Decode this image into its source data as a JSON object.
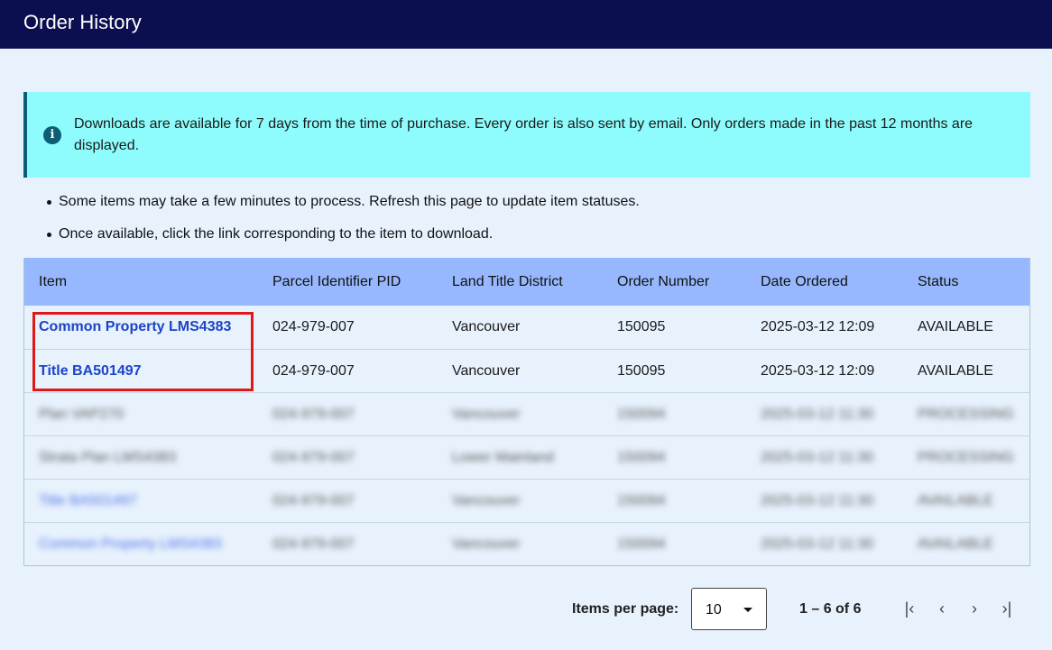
{
  "header": {
    "title": "Order History"
  },
  "info": {
    "icon": "info-icon",
    "text": "Downloads are available for 7 days from the time of purchase. Every order is also sent by email. Only orders made in the past 12 months are displayed."
  },
  "notes": [
    "Some items may take a few minutes to process. Refresh this page to update item statuses.",
    "Once available, click the link corresponding to the item to download."
  ],
  "table": {
    "columns": [
      "Item",
      "Parcel Identifier PID",
      "Land Title District",
      "Order Number",
      "Date Ordered",
      "Status"
    ],
    "rows": [
      {
        "item": "Common Property LMS4383",
        "pid": "024-979-007",
        "district": "Vancouver",
        "order": "150095",
        "date": "2025-03-12 12:09",
        "status": "AVAILABLE"
      },
      {
        "item": "Title BA501497",
        "pid": "024-979-007",
        "district": "Vancouver",
        "order": "150095",
        "date": "2025-03-12 12:09",
        "status": "AVAILABLE"
      },
      {
        "item": "Plan VAP270",
        "pid": "024-979-007",
        "district": "Vancouver",
        "order": "150094",
        "date": "2025-03-12 11:30",
        "status": "PROCESSING"
      },
      {
        "item": "Strata Plan LMS4383",
        "pid": "024-979-007",
        "district": "Lower Mainland",
        "order": "150094",
        "date": "2025-03-12 11:30",
        "status": "PROCESSING"
      },
      {
        "item": "Title BA501497",
        "pid": "024-979-007",
        "district": "Vancouver",
        "order": "150094",
        "date": "2025-03-12 11:30",
        "status": "AVAILABLE"
      },
      {
        "item": "Common Property LMS4383",
        "pid": "024-979-007",
        "district": "Vancouver",
        "order": "150094",
        "date": "2025-03-12 11:30",
        "status": "AVAILABLE"
      }
    ]
  },
  "pagination": {
    "items_per_page_label": "Items per page:",
    "items_per_page_value": "10",
    "range": "1 – 6 of 6",
    "first_icon": "first-page-icon",
    "prev_icon": "previous-page-icon",
    "next_icon": "next-page-icon",
    "last_icon": "last-page-icon"
  },
  "colors": {
    "header": "#0c0f4f",
    "info_bg": "#8efcfc",
    "table_header": "#97b8fe",
    "link": "#1b44c8",
    "highlight": "#e01818"
  }
}
